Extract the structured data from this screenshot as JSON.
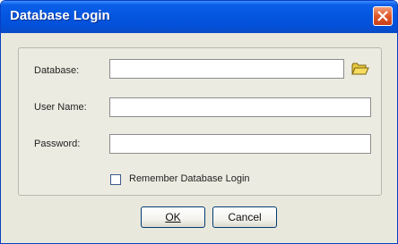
{
  "window": {
    "title": "Database Login"
  },
  "form": {
    "database_label": "Database:",
    "database_value": "",
    "username_label": "User Name:",
    "username_value": "",
    "password_label": "Password:",
    "password_value": "",
    "remember_label": "Remember Database Login",
    "remember_checked": false
  },
  "buttons": {
    "ok_label": "OK",
    "cancel_label": "Cancel"
  },
  "icons": {
    "close": "close-icon",
    "browse": "folder-icon"
  },
  "colors": {
    "titlebar": "#0456e0",
    "close_button": "#e0582a",
    "dialog_background": "#e9e8dc"
  }
}
